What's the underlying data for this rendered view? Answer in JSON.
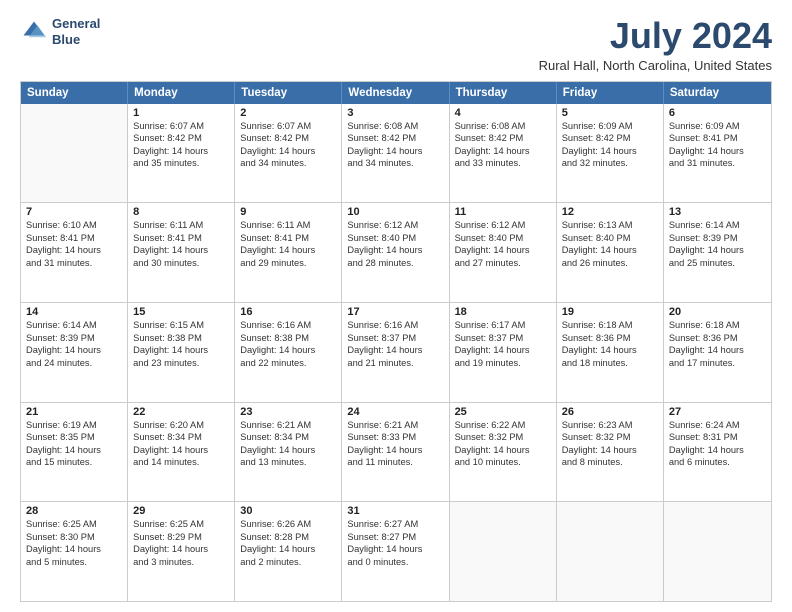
{
  "logo": {
    "line1": "General",
    "line2": "Blue"
  },
  "title": "July 2024",
  "subtitle": "Rural Hall, North Carolina, United States",
  "header_days": [
    "Sunday",
    "Monday",
    "Tuesday",
    "Wednesday",
    "Thursday",
    "Friday",
    "Saturday"
  ],
  "weeks": [
    [
      {
        "day": "",
        "empty": true
      },
      {
        "day": "1",
        "sunrise": "Sunrise: 6:07 AM",
        "sunset": "Sunset: 8:42 PM",
        "daylight": "Daylight: 14 hours",
        "daylight2": "and 35 minutes."
      },
      {
        "day": "2",
        "sunrise": "Sunrise: 6:07 AM",
        "sunset": "Sunset: 8:42 PM",
        "daylight": "Daylight: 14 hours",
        "daylight2": "and 34 minutes."
      },
      {
        "day": "3",
        "sunrise": "Sunrise: 6:08 AM",
        "sunset": "Sunset: 8:42 PM",
        "daylight": "Daylight: 14 hours",
        "daylight2": "and 34 minutes."
      },
      {
        "day": "4",
        "sunrise": "Sunrise: 6:08 AM",
        "sunset": "Sunset: 8:42 PM",
        "daylight": "Daylight: 14 hours",
        "daylight2": "and 33 minutes."
      },
      {
        "day": "5",
        "sunrise": "Sunrise: 6:09 AM",
        "sunset": "Sunset: 8:42 PM",
        "daylight": "Daylight: 14 hours",
        "daylight2": "and 32 minutes."
      },
      {
        "day": "6",
        "sunrise": "Sunrise: 6:09 AM",
        "sunset": "Sunset: 8:41 PM",
        "daylight": "Daylight: 14 hours",
        "daylight2": "and 31 minutes."
      }
    ],
    [
      {
        "day": "7",
        "sunrise": "Sunrise: 6:10 AM",
        "sunset": "Sunset: 8:41 PM",
        "daylight": "Daylight: 14 hours",
        "daylight2": "and 31 minutes."
      },
      {
        "day": "8",
        "sunrise": "Sunrise: 6:11 AM",
        "sunset": "Sunset: 8:41 PM",
        "daylight": "Daylight: 14 hours",
        "daylight2": "and 30 minutes."
      },
      {
        "day": "9",
        "sunrise": "Sunrise: 6:11 AM",
        "sunset": "Sunset: 8:41 PM",
        "daylight": "Daylight: 14 hours",
        "daylight2": "and 29 minutes."
      },
      {
        "day": "10",
        "sunrise": "Sunrise: 6:12 AM",
        "sunset": "Sunset: 8:40 PM",
        "daylight": "Daylight: 14 hours",
        "daylight2": "and 28 minutes."
      },
      {
        "day": "11",
        "sunrise": "Sunrise: 6:12 AM",
        "sunset": "Sunset: 8:40 PM",
        "daylight": "Daylight: 14 hours",
        "daylight2": "and 27 minutes."
      },
      {
        "day": "12",
        "sunrise": "Sunrise: 6:13 AM",
        "sunset": "Sunset: 8:40 PM",
        "daylight": "Daylight: 14 hours",
        "daylight2": "and 26 minutes."
      },
      {
        "day": "13",
        "sunrise": "Sunrise: 6:14 AM",
        "sunset": "Sunset: 8:39 PM",
        "daylight": "Daylight: 14 hours",
        "daylight2": "and 25 minutes."
      }
    ],
    [
      {
        "day": "14",
        "sunrise": "Sunrise: 6:14 AM",
        "sunset": "Sunset: 8:39 PM",
        "daylight": "Daylight: 14 hours",
        "daylight2": "and 24 minutes."
      },
      {
        "day": "15",
        "sunrise": "Sunrise: 6:15 AM",
        "sunset": "Sunset: 8:38 PM",
        "daylight": "Daylight: 14 hours",
        "daylight2": "and 23 minutes."
      },
      {
        "day": "16",
        "sunrise": "Sunrise: 6:16 AM",
        "sunset": "Sunset: 8:38 PM",
        "daylight": "Daylight: 14 hours",
        "daylight2": "and 22 minutes."
      },
      {
        "day": "17",
        "sunrise": "Sunrise: 6:16 AM",
        "sunset": "Sunset: 8:37 PM",
        "daylight": "Daylight: 14 hours",
        "daylight2": "and 21 minutes."
      },
      {
        "day": "18",
        "sunrise": "Sunrise: 6:17 AM",
        "sunset": "Sunset: 8:37 PM",
        "daylight": "Daylight: 14 hours",
        "daylight2": "and 19 minutes."
      },
      {
        "day": "19",
        "sunrise": "Sunrise: 6:18 AM",
        "sunset": "Sunset: 8:36 PM",
        "daylight": "Daylight: 14 hours",
        "daylight2": "and 18 minutes."
      },
      {
        "day": "20",
        "sunrise": "Sunrise: 6:18 AM",
        "sunset": "Sunset: 8:36 PM",
        "daylight": "Daylight: 14 hours",
        "daylight2": "and 17 minutes."
      }
    ],
    [
      {
        "day": "21",
        "sunrise": "Sunrise: 6:19 AM",
        "sunset": "Sunset: 8:35 PM",
        "daylight": "Daylight: 14 hours",
        "daylight2": "and 15 minutes."
      },
      {
        "day": "22",
        "sunrise": "Sunrise: 6:20 AM",
        "sunset": "Sunset: 8:34 PM",
        "daylight": "Daylight: 14 hours",
        "daylight2": "and 14 minutes."
      },
      {
        "day": "23",
        "sunrise": "Sunrise: 6:21 AM",
        "sunset": "Sunset: 8:34 PM",
        "daylight": "Daylight: 14 hours",
        "daylight2": "and 13 minutes."
      },
      {
        "day": "24",
        "sunrise": "Sunrise: 6:21 AM",
        "sunset": "Sunset: 8:33 PM",
        "daylight": "Daylight: 14 hours",
        "daylight2": "and 11 minutes."
      },
      {
        "day": "25",
        "sunrise": "Sunrise: 6:22 AM",
        "sunset": "Sunset: 8:32 PM",
        "daylight": "Daylight: 14 hours",
        "daylight2": "and 10 minutes."
      },
      {
        "day": "26",
        "sunrise": "Sunrise: 6:23 AM",
        "sunset": "Sunset: 8:32 PM",
        "daylight": "Daylight: 14 hours",
        "daylight2": "and 8 minutes."
      },
      {
        "day": "27",
        "sunrise": "Sunrise: 6:24 AM",
        "sunset": "Sunset: 8:31 PM",
        "daylight": "Daylight: 14 hours",
        "daylight2": "and 6 minutes."
      }
    ],
    [
      {
        "day": "28",
        "sunrise": "Sunrise: 6:25 AM",
        "sunset": "Sunset: 8:30 PM",
        "daylight": "Daylight: 14 hours",
        "daylight2": "and 5 minutes."
      },
      {
        "day": "29",
        "sunrise": "Sunrise: 6:25 AM",
        "sunset": "Sunset: 8:29 PM",
        "daylight": "Daylight: 14 hours",
        "daylight2": "and 3 minutes."
      },
      {
        "day": "30",
        "sunrise": "Sunrise: 6:26 AM",
        "sunset": "Sunset: 8:28 PM",
        "daylight": "Daylight: 14 hours",
        "daylight2": "and 2 minutes."
      },
      {
        "day": "31",
        "sunrise": "Sunrise: 6:27 AM",
        "sunset": "Sunset: 8:27 PM",
        "daylight": "Daylight: 14 hours",
        "daylight2": "and 0 minutes."
      },
      {
        "day": "",
        "empty": true
      },
      {
        "day": "",
        "empty": true
      },
      {
        "day": "",
        "empty": true
      }
    ]
  ]
}
